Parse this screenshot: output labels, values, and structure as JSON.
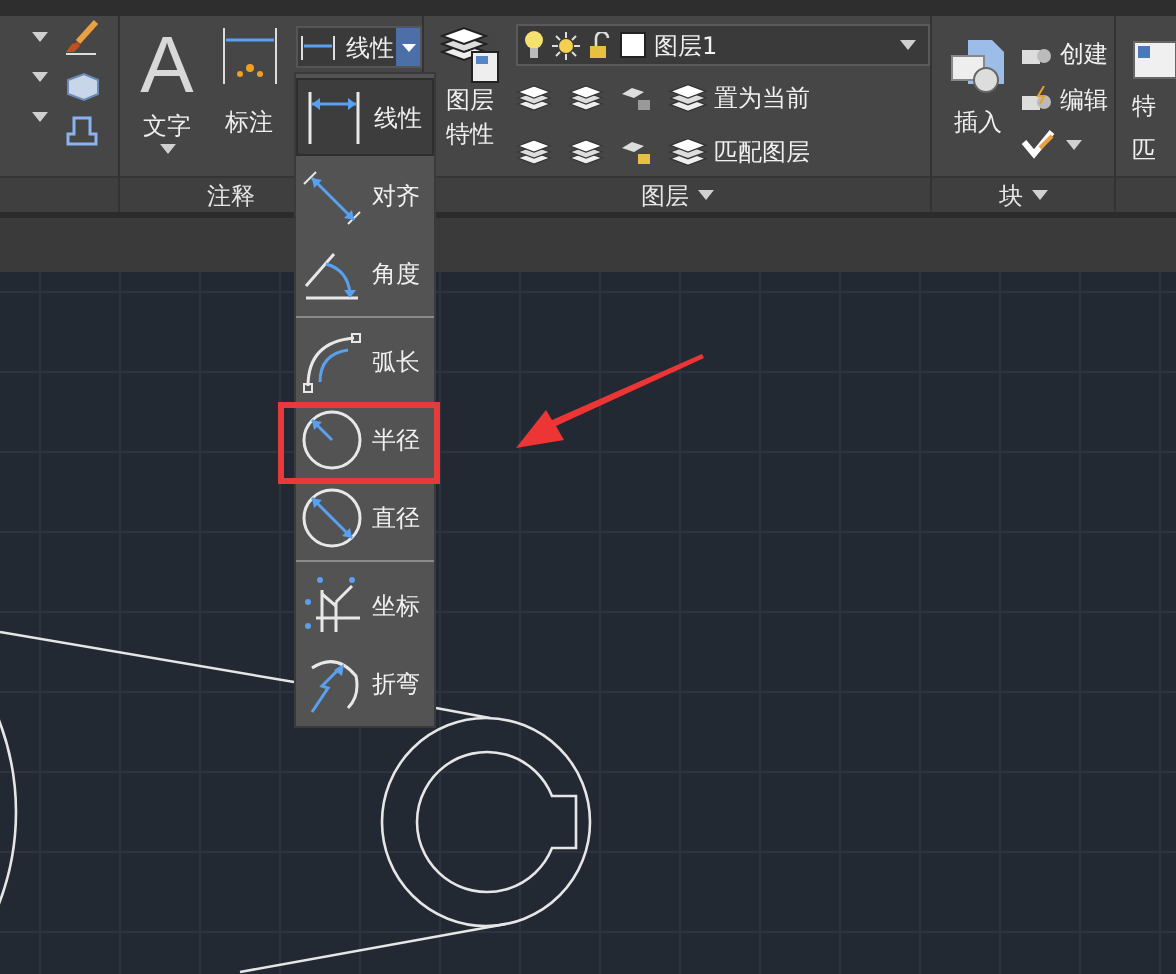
{
  "annotate_panel": {
    "title": "注释",
    "text_tool": {
      "glyph": "A",
      "label": "文字"
    },
    "dim_tool": {
      "label": "标注"
    },
    "dim_button": {
      "label": "线性"
    }
  },
  "layer_panel": {
    "title": "图层",
    "properties_tool": {
      "lines": [
        "图层",
        "特性"
      ]
    },
    "layer_combo": {
      "value": "图层1"
    },
    "actions": [
      "置为当前",
      "匹配图层"
    ]
  },
  "block_panel": {
    "title": "块",
    "insert": "插入",
    "actions": [
      "创建",
      "编辑"
    ]
  },
  "right_panel": {
    "texts": [
      "特",
      "匹"
    ]
  },
  "dim_menu": {
    "groups": [
      [
        {
          "kind": "linear",
          "label": "线性",
          "selected": true,
          "marked": false
        },
        {
          "kind": "aligned",
          "label": "对齐",
          "selected": false,
          "marked": false
        },
        {
          "kind": "angular",
          "label": "角度",
          "selected": false,
          "marked": false
        }
      ],
      [
        {
          "kind": "arc",
          "label": "弧长",
          "selected": false,
          "marked": false
        },
        {
          "kind": "radius",
          "label": "半径",
          "selected": false,
          "marked": true
        },
        {
          "kind": "diameter",
          "label": "直径",
          "selected": false,
          "marked": false
        }
      ],
      [
        {
          "kind": "ordinate",
          "label": "坐标",
          "selected": false,
          "marked": false
        },
        {
          "kind": "jogged",
          "label": "折弯",
          "selected": false,
          "marked": false
        }
      ]
    ]
  }
}
